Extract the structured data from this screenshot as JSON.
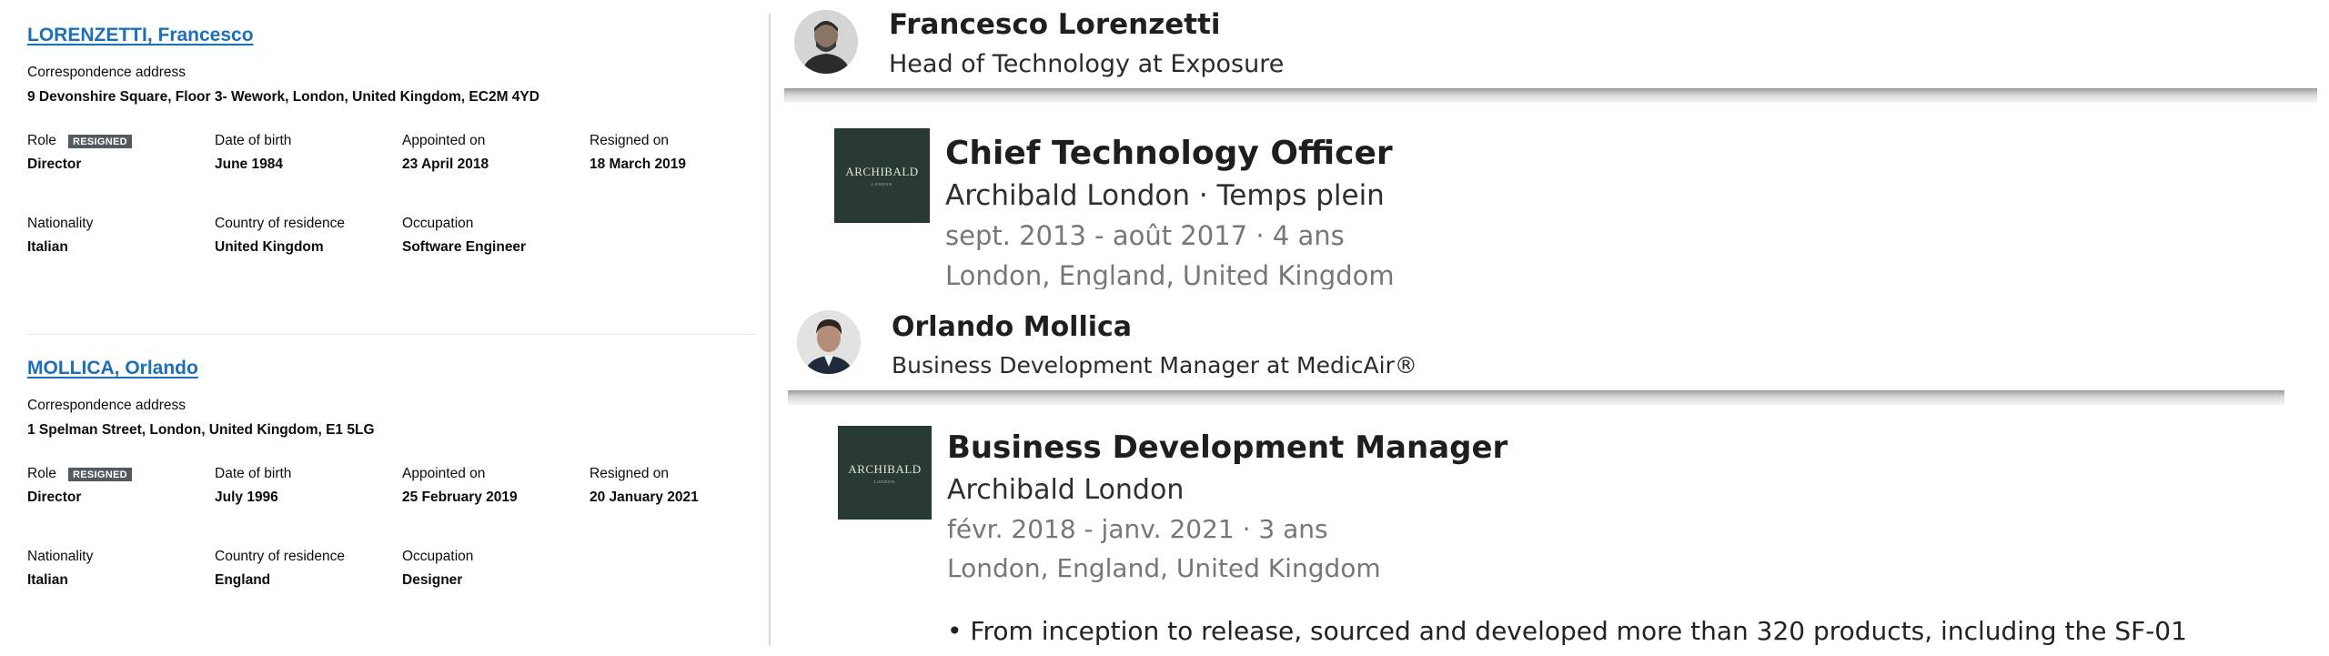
{
  "registry": {
    "officers": [
      {
        "name": "LORENZETTI, Francesco",
        "correspondence_label": "Correspondence address",
        "address": "9 Devonshire Square, Floor 3- Wework, London, United Kingdom, EC2M 4YD",
        "role_label": "Role",
        "status_badge": "RESIGNED",
        "role": "Director",
        "dob_label": "Date of birth",
        "dob": "June 1984",
        "appointed_label": "Appointed on",
        "appointed": "23 April 2018",
        "resigned_label": "Resigned on",
        "resigned": "18 March 2019",
        "nationality_label": "Nationality",
        "nationality": "Italian",
        "residence_label": "Country of residence",
        "residence": "United Kingdom",
        "occupation_label": "Occupation",
        "occupation": "Software Engineer"
      },
      {
        "name": "MOLLICA, Orlando",
        "correspondence_label": "Correspondence address",
        "address": "1 Spelman Street, London, United Kingdom, E1 5LG",
        "role_label": "Role",
        "status_badge": "RESIGNED",
        "role": "Director",
        "dob_label": "Date of birth",
        "dob": "July 1996",
        "appointed_label": "Appointed on",
        "appointed": "25 February 2019",
        "resigned_label": "Resigned on",
        "resigned": "20 January 2021",
        "nationality_label": "Nationality",
        "nationality": "Italian",
        "residence_label": "Country of residence",
        "residence": "England",
        "occupation_label": "Occupation",
        "occupation": "Designer"
      }
    ]
  },
  "profiles": [
    {
      "name": "Francesco Lorenzetti",
      "headline": "Head of Technology at Exposure",
      "experience": {
        "logo_text": "ARCHIBALD",
        "logo_subtext": "LONDON",
        "title": "Chief Technology Officer",
        "company": "Archibald London · Temps plein",
        "dates": "sept. 2013 - août 2017 · 4 ans",
        "location": "London, England, United Kingdom"
      }
    },
    {
      "name": "Orlando Mollica",
      "headline": "Business Development Manager at MedicAir®",
      "experience": {
        "logo_text": "ARCHIBALD",
        "logo_subtext": "LONDON",
        "title": "Business Development Manager",
        "company": "Archibald London",
        "dates": "févr. 2018 - janv. 2021 · 3 ans",
        "location": "London, England, United Kingdom",
        "bullet": "• From inception to release, sourced and developed more than 320 products, including the SF-01"
      }
    }
  ],
  "colors": {
    "link": "#1d70b8",
    "badge": "#505a5f",
    "logo_bg": "#283a33"
  }
}
